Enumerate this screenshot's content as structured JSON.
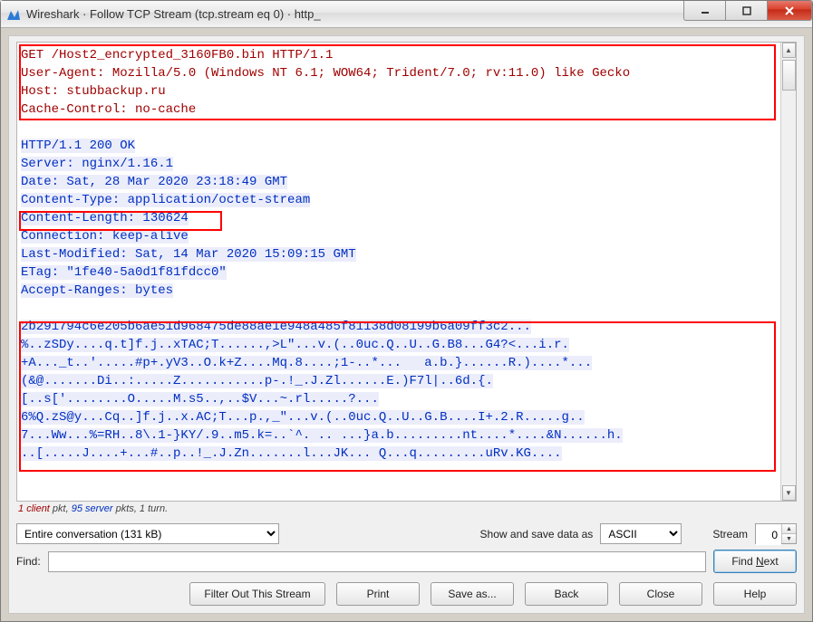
{
  "window": {
    "title": "Wireshark · Follow TCP Stream (tcp.stream eq 0) · http_"
  },
  "stream": {
    "request": "GET /Host2_encrypted_3160FB0.bin HTTP/1.1\nUser-Agent: Mozilla/5.0 (Windows NT 6.1; WOW64; Trident/7.0; rv:11.0) like Gecko\nHost: stubbackup.ru\nCache-Control: no-cache",
    "response_headers_pre": "HTTP/1.1 200 OK\nServer: nginx/1.16.1\nDate: Sat, 28 Mar 2020 23:18:49 GMT\nContent-Type: application/octet-stream",
    "response_content_length": "Content-Length: 130624",
    "response_headers_post": "Connection: keep-alive\nLast-Modified: Sat, 14 Mar 2020 15:09:15 GMT\nETag: \"1fe40-5a0d1f81fdcc0\"\nAccept-Ranges: bytes",
    "body": "2b291794c6e205b6ae51d968475de88ae1e948a485f81138d08199b6a09ff3c2...\n%..zSDy....q.t]f.j..xTAC;T......,>L\"...v.(..0uc.Q..U..G.B8...G4?<...i.r.\n+A..._t..'.....#p+.yV3..O.k+Z....Mq.8....;1-..*...   a.b.}......R.)....*...\n(&@.......Di..:.....Z...........p-.!_.J.Zl......E.)F7l|..6d.{.\n[..s['........O.....M.s5..,..$V...~.rl.....?...\n6%Q.zS@y...Cq..]f.j..x.AC;T...p.,_\"...v.(..0uc.Q..U..G.B....I+.2.R.....g..\n7...Ww...%=RH..8\\.1-}KY/.9..m5.k=..`^. .. ...}a.b.........nt....*....&N......h.\n..[.....J....+...#..p..!_.J.Zn.......l...JK... Q...q.........uRv.KG...."
  },
  "status": {
    "client_count": "1",
    "client_word": "client",
    "mid": " pkt, ",
    "server_count": "95",
    "server_word": "server",
    "tail": " pkts, 1 turn."
  },
  "controls": {
    "conversation_selected": "Entire conversation (131 kB)",
    "show_save_label": "Show and save data as",
    "encoding_selected": "ASCII",
    "stream_label": "Stream",
    "stream_value": "0",
    "find_label": "Find:",
    "find_value": "",
    "find_next": "Find Next"
  },
  "buttons": {
    "filter_out": "Filter Out This Stream",
    "print": "Print",
    "save_as": "Save as...",
    "back": "Back",
    "close": "Close",
    "help": "Help"
  }
}
